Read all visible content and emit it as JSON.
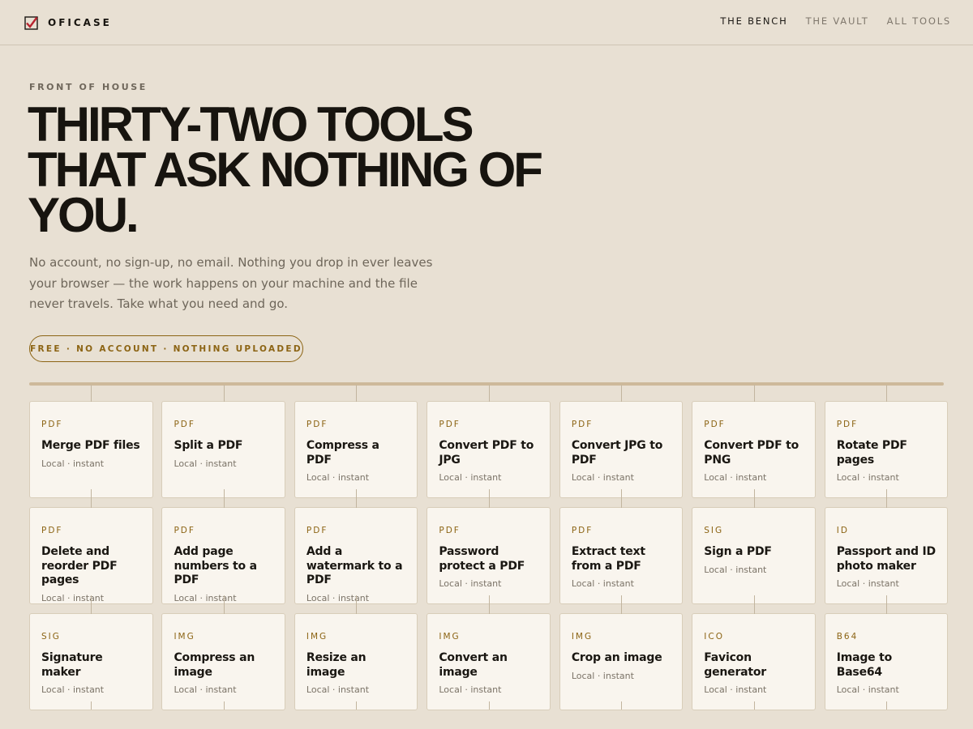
{
  "brand": {
    "name": "OFICASE"
  },
  "nav": [
    {
      "label": "THE BENCH",
      "active": true
    },
    {
      "label": "THE VAULT",
      "active": false
    },
    {
      "label": "ALL TOOLS",
      "active": false
    }
  ],
  "hero": {
    "eyebrow": "FRONT OF HOUSE",
    "title": "THIRTY-TWO TOOLS THAT ASK NOTHING OF YOU.",
    "description": "No account, no sign-up, no email. Nothing you drop in ever leaves your browser — the work happens on your machine and the file never travels. Take what you need and go.",
    "pill": "FREE · NO ACCOUNT · NOTHING UPLOADED"
  },
  "tools": [
    {
      "tag": "PDF",
      "title": "Merge PDF files",
      "meta": "Local · instant"
    },
    {
      "tag": "PDF",
      "title": "Split a PDF",
      "meta": "Local · instant"
    },
    {
      "tag": "PDF",
      "title": "Compress a PDF",
      "meta": "Local · instant"
    },
    {
      "tag": "PDF",
      "title": "Convert PDF to JPG",
      "meta": "Local · instant"
    },
    {
      "tag": "PDF",
      "title": "Convert JPG to PDF",
      "meta": "Local · instant"
    },
    {
      "tag": "PDF",
      "title": "Convert PDF to PNG",
      "meta": "Local · instant"
    },
    {
      "tag": "PDF",
      "title": "Rotate PDF pages",
      "meta": "Local · instant"
    },
    {
      "tag": "PDF",
      "title": "Delete and reorder PDF pages",
      "meta": "Local · instant"
    },
    {
      "tag": "PDF",
      "title": "Add page numbers to a PDF",
      "meta": "Local · instant"
    },
    {
      "tag": "PDF",
      "title": "Add a watermark to a PDF",
      "meta": "Local · instant"
    },
    {
      "tag": "PDF",
      "title": "Password protect a PDF",
      "meta": "Local · instant"
    },
    {
      "tag": "PDF",
      "title": "Extract text from a PDF",
      "meta": "Local · instant"
    },
    {
      "tag": "SIG",
      "title": "Sign a PDF",
      "meta": "Local · instant"
    },
    {
      "tag": "ID",
      "title": "Passport and ID photo maker",
      "meta": "Local · instant"
    },
    {
      "tag": "SIG",
      "title": "Signature maker",
      "meta": "Local · instant"
    },
    {
      "tag": "IMG",
      "title": "Compress an image",
      "meta": "Local · instant"
    },
    {
      "tag": "IMG",
      "title": "Resize an image",
      "meta": "Local · instant"
    },
    {
      "tag": "IMG",
      "title": "Convert an image",
      "meta": "Local · instant"
    },
    {
      "tag": "IMG",
      "title": "Crop an image",
      "meta": "Local · instant"
    },
    {
      "tag": "ICO",
      "title": "Favicon generator",
      "meta": "Local · instant"
    },
    {
      "tag": "B64",
      "title": "Image to Base64",
      "meta": "Local · instant"
    }
  ],
  "colors": {
    "background": "#e8e0d3",
    "accent": "#8c6414",
    "logo_mark": "#b8232f",
    "card": "#f9f5ee"
  }
}
